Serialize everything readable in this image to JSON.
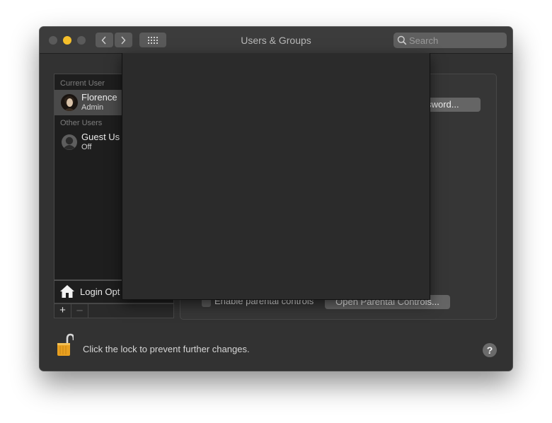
{
  "window": {
    "title": "Users & Groups",
    "search_placeholder": "Search"
  },
  "sidebar": {
    "current_user_label": "Current User",
    "other_users_label": "Other Users",
    "users": [
      {
        "name": "Florence",
        "role": "Admin"
      },
      {
        "name": "Guest Us",
        "role": "Off"
      }
    ],
    "login_options_label": "Login Opt",
    "add_symbol": "+",
    "remove_symbol": "–"
  },
  "content": {
    "change_password_label": "assword...",
    "parental_controls_checkbox_label": "Enable parental controls",
    "parental_controls_checked": false,
    "open_parental_controls_label": "Open Parental Controls..."
  },
  "footer": {
    "lock_text": "Click the lock to prevent further changes.",
    "help_symbol": "?"
  },
  "colors": {
    "window_bg": "#323232",
    "sidebar_bg": "#1e1e1e",
    "selection_bg": "#4a4a4a",
    "minimize_light": "#f5bf2a",
    "lock_gold": "#e8a020"
  },
  "icons": {
    "back": "chevron-left-icon",
    "forward": "chevron-right-icon",
    "show_all": "grid-icon",
    "search": "search-icon",
    "guest_avatar": "person-silhouette-icon",
    "login_options": "house-icon",
    "lock": "lock-open-icon",
    "help": "question-mark-icon"
  }
}
